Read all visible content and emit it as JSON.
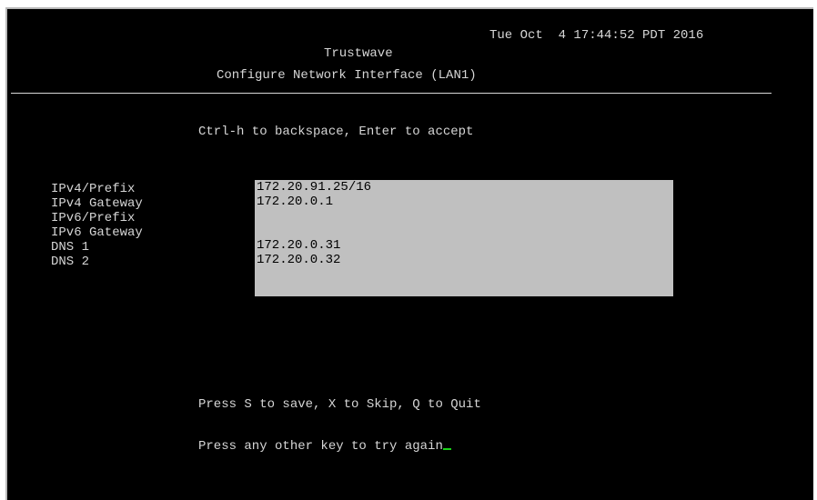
{
  "header": {
    "clock": "Tue Oct  4 17:44:52 PDT 2016",
    "brand": "Trustwave",
    "subtitle": "Configure Network Interface (LAN1)"
  },
  "instruction": "Ctrl-h to backspace, Enter to accept",
  "fields": [
    {
      "label": "IPv4/Prefix",
      "value": "172.20.91.25/16"
    },
    {
      "label": "IPv4 Gateway",
      "value": "172.20.0.1"
    },
    {
      "label": "IPv6/Prefix",
      "value": ""
    },
    {
      "label": "IPv6 Gateway",
      "value": ""
    },
    {
      "label": "DNS 1",
      "value": "172.20.0.31"
    },
    {
      "label": "DNS 2",
      "value": "172.20.0.32"
    }
  ],
  "footer": {
    "actions": "Press S to save, X to Skip, Q to Quit",
    "retry": "Press any other key to try again"
  },
  "colors": {
    "background": "#000000",
    "text": "#d6d6d6",
    "field_background": "#c0c0c0",
    "cursor": "#19d219"
  }
}
